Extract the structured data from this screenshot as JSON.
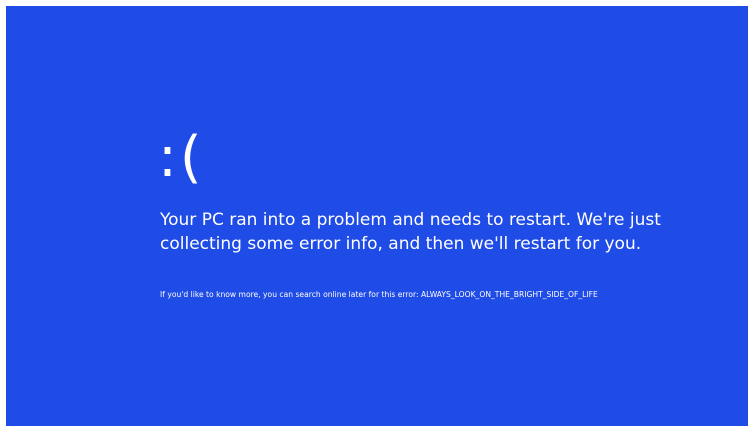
{
  "bsod": {
    "face": ":(",
    "message": "Your PC ran into a problem and needs to restart. We're just\ncollecting some error info, and then we'll restart for you.",
    "details": "If you'd like to know more, you can search online later for this error: ALWAYS_LOOK_ON_THE_BRIGHT_SIDE_OF_LIFE"
  },
  "colors": {
    "background": "#1f4be6",
    "text": "#ffffff"
  }
}
